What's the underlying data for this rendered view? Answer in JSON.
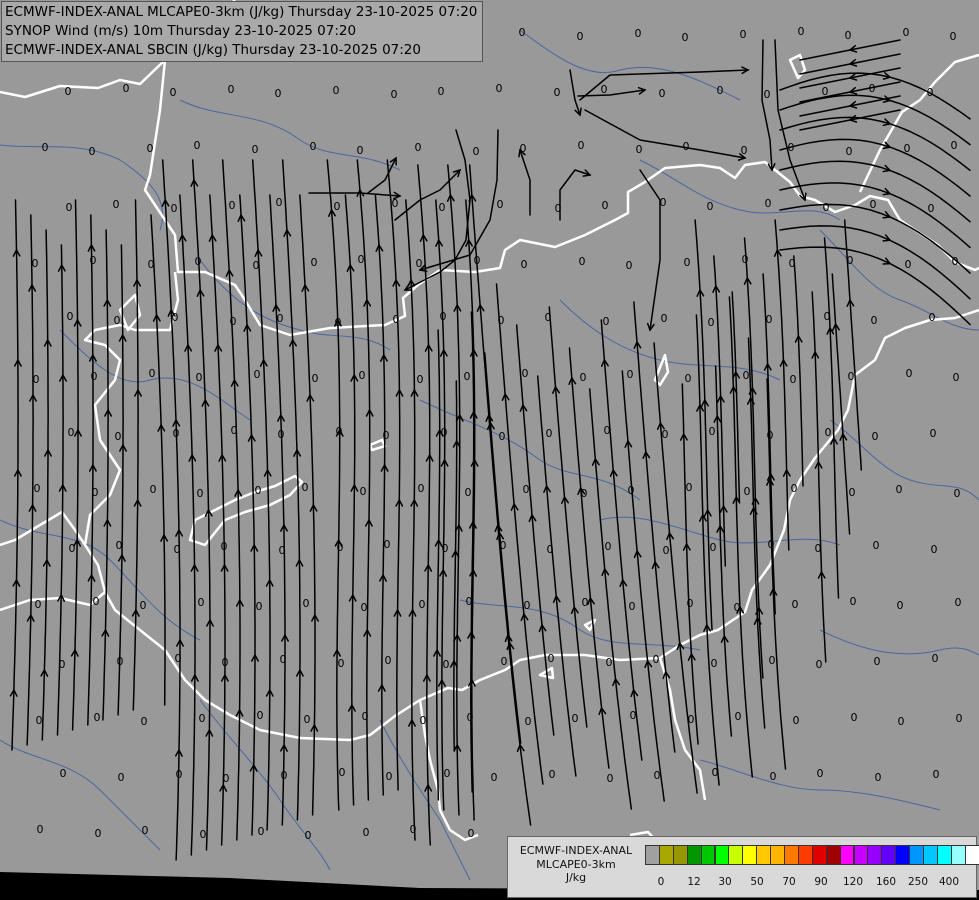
{
  "header": {
    "lines": [
      "ECMWF-INDEX-ANAL MLCAPE0-3km (J/kg) Thursday 23-10-2025 07:20",
      "SYNOP Wind (m/s) 10m Thursday 23-10-2025 07:20",
      "ECMWF-INDEX-ANAL SBCIN (J/kg) Thursday 23-10-2025 07:20"
    ]
  },
  "legend": {
    "title_line1": "ECMWF-INDEX-ANAL",
    "title_line2": "MLCAPE0-3km",
    "unit": "J/kg",
    "colors": [
      "#a0a0a0",
      "#a8a800",
      "#969600",
      "#009600",
      "#00c800",
      "#00ff00",
      "#c8ff00",
      "#ffff00",
      "#ffc800",
      "#ffb400",
      "#ff7800",
      "#ff3c00",
      "#e10000",
      "#a00000",
      "#ff00ff",
      "#c800ff",
      "#9600ff",
      "#6400ff",
      "#0000ff",
      "#0096ff",
      "#00c8ff",
      "#00ffff",
      "#96ffff",
      "#ffffff"
    ],
    "tick_labels": [
      "0",
      "12",
      "30",
      "50",
      "70",
      "90",
      "120",
      "160",
      "250",
      "400"
    ]
  },
  "map": {
    "background_color": "#999999",
    "bottom_strip_color": "#000000",
    "border_color": "#ffffff",
    "region_line_color": "#3c5fa0",
    "streamline_color": "#000000",
    "value_label": "0"
  }
}
